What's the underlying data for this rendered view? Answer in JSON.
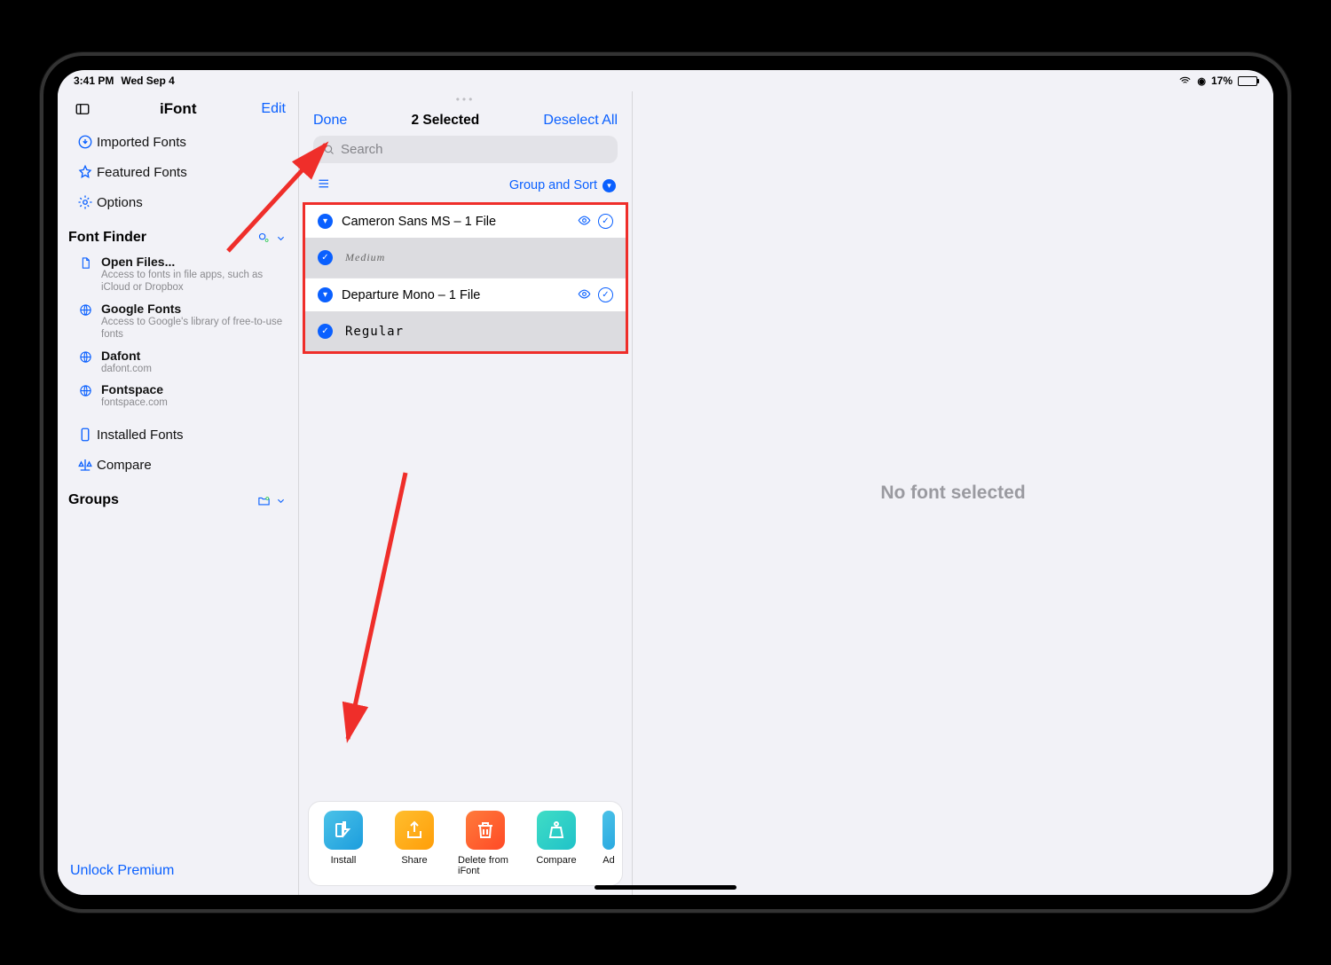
{
  "statusBar": {
    "time": "3:41 PM",
    "date": "Wed Sep 4",
    "batteryPct": "17%",
    "locationGlyph": "➤",
    "wifiGlyph": "⌃"
  },
  "sidebar": {
    "title": "iFont",
    "editLabel": "Edit",
    "items": {
      "imported": "Imported Fonts",
      "featured": "Featured Fonts",
      "options": "Options",
      "installed": "Installed Fonts",
      "compare": "Compare"
    },
    "fontFinderHeading": "Font Finder",
    "finder": {
      "openFiles": {
        "title": "Open Files...",
        "sub": "Access to fonts in file apps, such as iCloud or Dropbox"
      },
      "google": {
        "title": "Google Fonts",
        "sub": "Access to Google's library of free-to-use fonts"
      },
      "dafont": {
        "title": "Dafont",
        "sub": "dafont.com"
      },
      "fontspace": {
        "title": "Fontspace",
        "sub": "fontspace.com"
      }
    },
    "groupsHeading": "Groups",
    "unlock": "Unlock Premium"
  },
  "middle": {
    "done": "Done",
    "selectedCount": "2 Selected",
    "deselect": "Deselect All",
    "searchPlaceholder": "Search",
    "groupSort": "Group and Sort",
    "fonts": [
      {
        "name": "Cameron Sans MS – 1 File",
        "variant": "Medium"
      },
      {
        "name": "Departure Mono – 1 File",
        "variant": "Regular"
      }
    ],
    "tools": {
      "install": "Install",
      "share": "Share",
      "delete": "Delete from iFont",
      "compare": "Compare",
      "extra": "Ad"
    }
  },
  "detail": {
    "empty": "No font selected"
  }
}
